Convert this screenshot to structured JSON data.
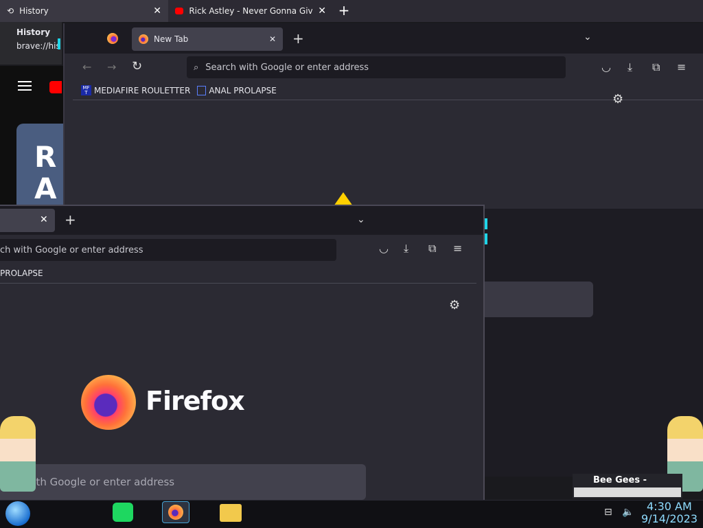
{
  "brave": {
    "tabs": [
      {
        "label": "History"
      },
      {
        "label": "Rick Astley - Never Gonna Give Yo"
      }
    ],
    "tooltip": {
      "title": "History",
      "url": "brave://his"
    },
    "yt_card_text": "R\nA"
  },
  "firefox_back": {
    "tab_label": "New Tab",
    "url_placeholder": "Search with Google or enter address",
    "bookmarks": [
      {
        "label": "MEDIAFIRE ROULETTER",
        "icon_text": "MF T"
      },
      {
        "label": "ANAL PROLAPSE"
      }
    ]
  },
  "firefox_front": {
    "url_placeholder_partial": "ch with Google or enter address",
    "bookmark_partial": "PROLAPSE",
    "brand": "Firefox",
    "search_placeholder_partial": "with Google or enter address"
  },
  "taskbar": {
    "time": "4:30 AM",
    "date": "9/14/2023",
    "media_title": "Bee Gees -"
  },
  "colors": {
    "accent": "#1fd5e8",
    "window_bg": "#2b2a33",
    "tabstrip_bg": "#1c1b22"
  }
}
